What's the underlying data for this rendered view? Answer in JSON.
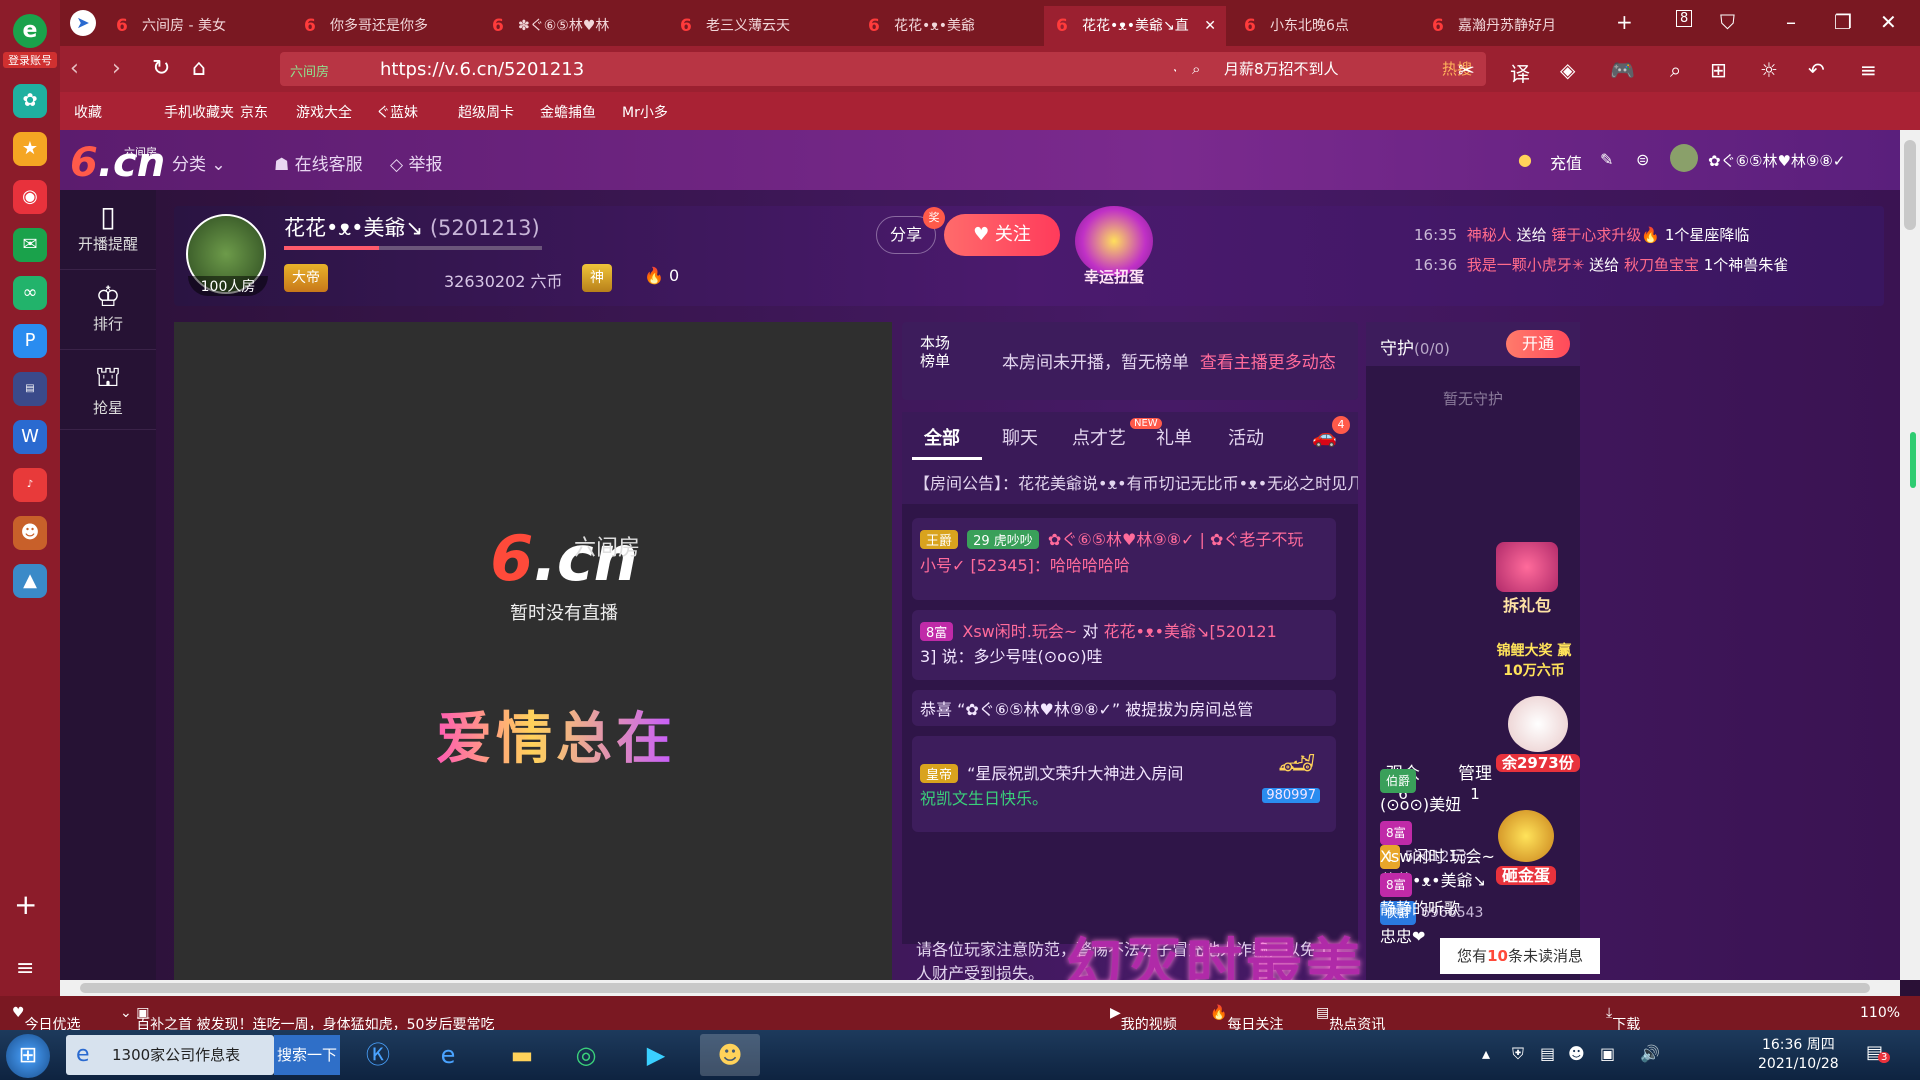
{
  "system_sidebar": {
    "login_label": "登录账号",
    "icons": [
      "leaf-icon",
      "star-icon",
      "weibo-icon",
      "mail-icon",
      "app-icon",
      "p-icon",
      "news-icon",
      "word-icon",
      "music-icon",
      "game-icon",
      "photo-icon"
    ]
  },
  "tabs": [
    {
      "title": "六间房 - 美女",
      "active": false
    },
    {
      "title": "你多哥还是你多",
      "active": false
    },
    {
      "title": "✽ぐ⑥⑤林♥林",
      "active": false
    },
    {
      "title": "老三义薄云天",
      "active": false
    },
    {
      "title": "花花•ᴥ•美爺",
      "active": false
    },
    {
      "title": "花花•ᴥ•美爺↘直",
      "active": true
    },
    {
      "title": "小东北晚6点",
      "active": false
    },
    {
      "title": "嘉瀚丹苏静好月",
      "active": false
    }
  ],
  "tab_count": "8",
  "address": {
    "site_label": "六间房",
    "url": "https://v.6.cn/5201213"
  },
  "search": {
    "text": "月薪8万招不到人",
    "hot": "热搜"
  },
  "bookmarks": [
    "收藏",
    "手机收藏夹",
    "京东",
    "游戏大全",
    "ぐ蓝妹",
    "超级周卡",
    "金蟾捕鱼",
    "Mr小多"
  ],
  "site_header": {
    "logo_sub": "六间房",
    "category": "分类",
    "service": "在线客服",
    "report": "举报",
    "recharge": "充值",
    "username": "✿ぐ⑥⑤林♥林⑨⑧✓"
  },
  "left_nav": [
    {
      "label": "开播提醒"
    },
    {
      "label": "排行"
    },
    {
      "label": "抢星"
    }
  ],
  "streamer": {
    "name": "花花•ᴥ•美爺↘",
    "id": "(5201213)",
    "room_size": "100人房",
    "level_badge": "大帝",
    "coins": "32630202 六币",
    "god_badge": "神",
    "heat": "0",
    "level_progress": 0.37,
    "share": "分享",
    "share_tag": "奖",
    "follow": "关注",
    "lucky": "幸运扭蛋"
  },
  "top_messages": [
    {
      "time": "16:35",
      "from": "神秘人",
      "verb": "送给",
      "to": "锤于心求升级🔥",
      "gift": "1个星座降临"
    },
    {
      "time": "16:36",
      "from": "我是一颗小虎牙✳",
      "verb": "送给",
      "to": "秋刀鱼宝宝",
      "gift": "1个神兽朱雀"
    }
  ],
  "video": {
    "logo_sub": "六间房",
    "no_live": "暂时没有直播",
    "overlay": "爱情总在"
  },
  "rank_panel": {
    "label": "本场榜单",
    "text": "本房间未开播，暂无榜单",
    "more": "查看主播更多动态"
  },
  "chat_tabs": [
    {
      "label": "全部",
      "active": true
    },
    {
      "label": "聊天",
      "active": false
    },
    {
      "label": "点才艺",
      "active": false
    },
    {
      "label": "礼单",
      "active": false
    },
    {
      "label": "活动",
      "active": false
    }
  ],
  "chat_new_tag": "NEW",
  "car_count": "4",
  "notice": "【房间公告】：花花美爺说•ᴥ•有币切记无比币•ᴥ•无必之时见几人",
  "chat_messages": [
    {
      "badge": "王爵",
      "level": "29",
      "name": "虎吵吵",
      "user": "✿ぐ⑥⑤林♥林⑨⑧✓ | ✿ぐ老子不玩",
      "text": "小号✓ [52345]：哈哈哈哈哈"
    },
    {
      "badge": "8富",
      "user": "Xsw闲时.玩会~",
      "to": "花花•ᴥ•美爺↘[520121",
      "text": "3] 说：多少号哇(⊙o⊙)哇"
    },
    {
      "text": "恭喜 “✿ぐ⑥⑤林♥林⑨⑧✓” 被提拔为房间总管"
    },
    {
      "badge": "皇帝",
      "text": "“星辰祝凯文荣升大神进入房间",
      "sub": "祝凯文生日快乐。",
      "car_id": "980997"
    }
  ],
  "chat_footer": "请各位玩家注意防范，警惕不法分子冒充他人诈骗，以免个人财产受到损失。",
  "guard": {
    "title": "守护",
    "count": "(0/0)",
    "open": "开通",
    "none": "暂无守护",
    "tabs": [
      {
        "label": "观众",
        "count": "6"
      },
      {
        "label": "管理",
        "count": "1"
      }
    ],
    "audience": [
      {
        "badge": "1",
        "id": "5201213",
        "name": "花花•ᴥ•美爺↘"
      },
      {
        "badge": "侠爵",
        "id": "6966543",
        "name": "忠忠❤"
      },
      {
        "badge": "伯爵",
        "name": "(⊙o⊙)美妞"
      },
      {
        "badge": "8富",
        "name": "Xsw闲时.玩会~"
      },
      {
        "badge": "8富",
        "name": "静静的听歌"
      }
    ]
  },
  "side_promos": [
    {
      "label": "拆礼包"
    },
    {
      "label": "锦鲤大奖 赢10万六币"
    },
    {
      "label": "余2973份"
    },
    {
      "label": "砸金蛋"
    }
  ],
  "unread": {
    "pre": "您有",
    "count": "10",
    "post": "条未读消息"
  },
  "bottom_overlay": "幻灭时最美",
  "statusbar": {
    "today": "今日优选",
    "news": "百补之首 被发现！连吃一周，身体猛如虎，50岁后要常吃",
    "my_video": "我的视频",
    "daily": "每日关注",
    "hot_news": "热点资讯",
    "download": "下载",
    "zoom": "110%"
  },
  "taskbar": {
    "ie_label": "1300家公司作息表",
    "search_btn": "搜索一下",
    "time": "16:36 周四",
    "date": "2021/10/28",
    "notif": "3"
  }
}
